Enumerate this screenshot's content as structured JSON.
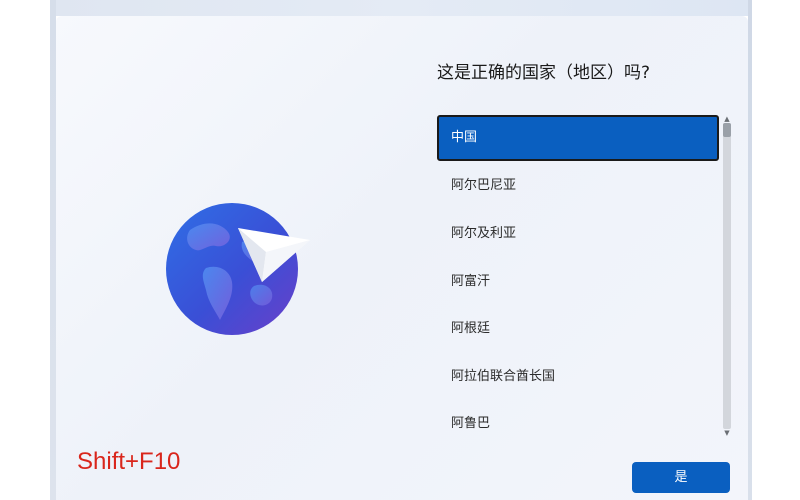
{
  "setup": {
    "title": "这是正确的国家（地区）吗?",
    "region_list": {
      "selected_index": 0,
      "items": [
        "中国",
        "阿尔巴尼亚",
        "阿尔及利亚",
        "阿富汗",
        "阿根廷",
        "阿拉伯联合酋长国",
        "阿鲁巴"
      ]
    },
    "confirm_button_label": "是",
    "icons": {
      "illustration": "globe-with-paper-plane-icon",
      "scroll_up": "chevron-up-icon",
      "scroll_down": "chevron-down-icon"
    }
  },
  "annotation": {
    "hotkey_text": "Shift+F10",
    "color": "#d9261c"
  },
  "colors": {
    "accent": "#0a5fc0",
    "panel_background": "#f3f5fb",
    "text": "#1a1a1a"
  }
}
